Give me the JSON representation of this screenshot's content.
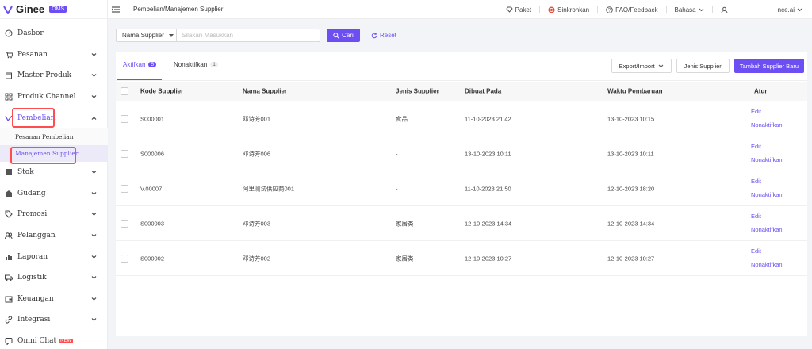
{
  "app": {
    "name": "Ginee",
    "badge": "OMS"
  },
  "topbar": {
    "breadcrumb": "Pembelian/Manajemen Supplier",
    "paket": "Paket",
    "sinkronkan": "Sinkronkan",
    "faq": "FAQ/Feedback",
    "language": "Bahasa",
    "account": "nce.ai"
  },
  "sidebar": {
    "items": [
      {
        "label": "Dasbor",
        "icon": "dashboard-icon"
      },
      {
        "label": "Pesanan",
        "icon": "cart-icon"
      },
      {
        "label": "Master Produk",
        "icon": "box-icon"
      },
      {
        "label": "Produk Channel",
        "icon": "grid-icon"
      },
      {
        "label": "Pembelian",
        "icon": "purchase-icon"
      },
      {
        "label": "Stok",
        "icon": "stock-icon"
      },
      {
        "label": "Gudang",
        "icon": "warehouse-icon"
      },
      {
        "label": "Promosi",
        "icon": "tag-icon"
      },
      {
        "label": "Pelanggan",
        "icon": "users-icon"
      },
      {
        "label": "Laporan",
        "icon": "chart-icon"
      },
      {
        "label": "Logistik",
        "icon": "truck-icon"
      },
      {
        "label": "Keuangan",
        "icon": "wallet-icon"
      },
      {
        "label": "Integrasi",
        "icon": "link-icon"
      },
      {
        "label": "Omni Chat",
        "icon": "chat-icon",
        "badge": "NEW"
      }
    ],
    "sub_items": [
      {
        "label": "Pesanan Pembelian"
      },
      {
        "label": "Manajemen Supplier"
      }
    ]
  },
  "filter": {
    "select_label": "Nama Supplier",
    "placeholder": "Silakan Masukkan",
    "search_label": "Cari",
    "reset_label": "Reset"
  },
  "tabs": [
    {
      "label": "Aktifkan",
      "count": "5"
    },
    {
      "label": "Nonaktifkan",
      "count": "1"
    }
  ],
  "actions": {
    "export_import": "Export/Import",
    "supplier_type": "Jenis Supplier",
    "add_supplier": "Tambah Supplier Baru"
  },
  "table": {
    "headers": [
      "Kode Supplier",
      "Nama Supplier",
      "Jenis Supplier",
      "Dibuat Pada",
      "Waktu Pembaruan",
      "Atur"
    ],
    "rows": [
      {
        "code": "S000001",
        "name": "邓诗芳001",
        "type": "食品",
        "created": "11-10-2023 21:42",
        "updated": "13-10-2023 10:15"
      },
      {
        "code": "S000006",
        "name": "邓诗芳006",
        "type": "-",
        "created": "13-10-2023 10:11",
        "updated": "13-10-2023 10:11"
      },
      {
        "code": "V.00007",
        "name": "阿里测试供应商001",
        "type": "-",
        "created": "11-10-2023 21:50",
        "updated": "12-10-2023 18:20"
      },
      {
        "code": "S000003",
        "name": "邓诗芳003",
        "type": "家居类",
        "created": "12-10-2023 14:34",
        "updated": "12-10-2023 14:34"
      },
      {
        "code": "S000002",
        "name": "邓诗芳002",
        "type": "家居类",
        "created": "12-10-2023 10:27",
        "updated": "12-10-2023 10:27"
      }
    ],
    "edit_label": "Edit",
    "deactivate_label": "Nonaktifkan"
  },
  "colors": {
    "accent": "#6c4ef2",
    "highlight": "#ff4d4f"
  }
}
